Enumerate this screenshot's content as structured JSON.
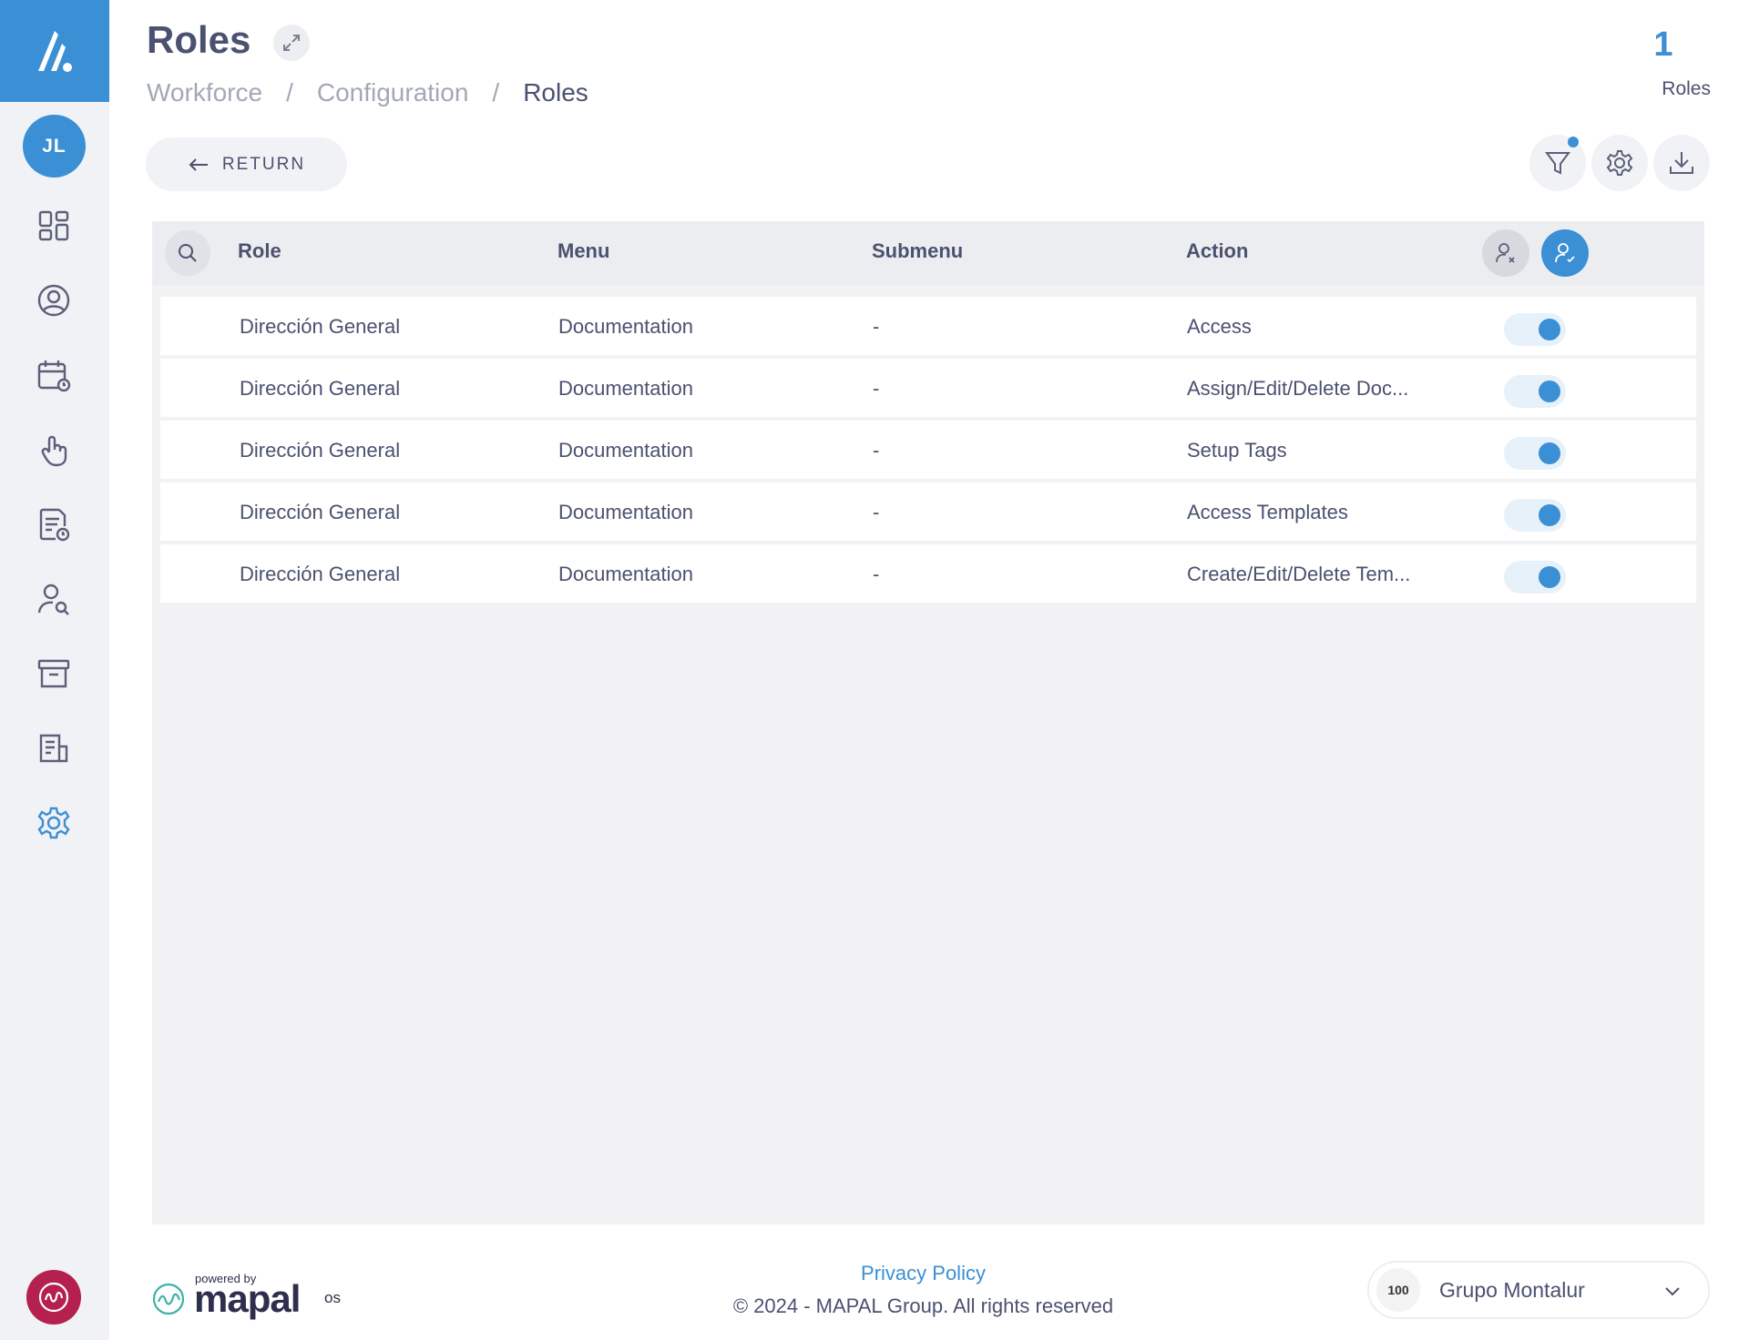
{
  "sidebar": {
    "avatar_initials": "JL",
    "nav_items": [
      {
        "icon": "dashboard-icon"
      },
      {
        "icon": "user-circle-icon"
      },
      {
        "icon": "calendar-clock-icon"
      },
      {
        "icon": "hand-pointer-icon"
      },
      {
        "icon": "document-clock-icon"
      },
      {
        "icon": "user-search-icon"
      },
      {
        "icon": "archive-box-icon"
      },
      {
        "icon": "report-icon"
      },
      {
        "icon": "settings-icon",
        "active": true
      }
    ]
  },
  "header": {
    "title": "Roles",
    "breadcrumb": [
      "Workforce",
      "Configuration",
      "Roles"
    ],
    "count_value": "1",
    "count_label": "Roles"
  },
  "toolbar": {
    "return_label": "RETURN"
  },
  "table": {
    "columns": [
      "Role",
      "Menu",
      "Submenu",
      "Action"
    ],
    "rows": [
      {
        "role": "Dirección General",
        "menu": "Documentation",
        "submenu": "-",
        "action": "Access",
        "enabled": true
      },
      {
        "role": "Dirección General",
        "menu": "Documentation",
        "submenu": "-",
        "action": "Assign/Edit/Delete Doc...",
        "enabled": true
      },
      {
        "role": "Dirección General",
        "menu": "Documentation",
        "submenu": "-",
        "action": "Setup Tags",
        "enabled": true
      },
      {
        "role": "Dirección General",
        "menu": "Documentation",
        "submenu": "-",
        "action": "Access Templates",
        "enabled": true
      },
      {
        "role": "Dirección General",
        "menu": "Documentation",
        "submenu": "-",
        "action": "Create/Edit/Delete Tem...",
        "enabled": true
      }
    ]
  },
  "footer": {
    "powered_by": "powered by",
    "brand": "mapal",
    "brand_suffix": "os",
    "privacy_label": "Privacy Policy",
    "copyright": "© 2024 - MAPAL Group. All rights reserved",
    "company_logo_text": "100",
    "company_name": "Grupo Montalur"
  },
  "colors": {
    "accent": "#3b8fd4",
    "sidebar_bg": "#f1f2f5",
    "text": "#4b5170",
    "bottom_logo": "#b5214f"
  }
}
